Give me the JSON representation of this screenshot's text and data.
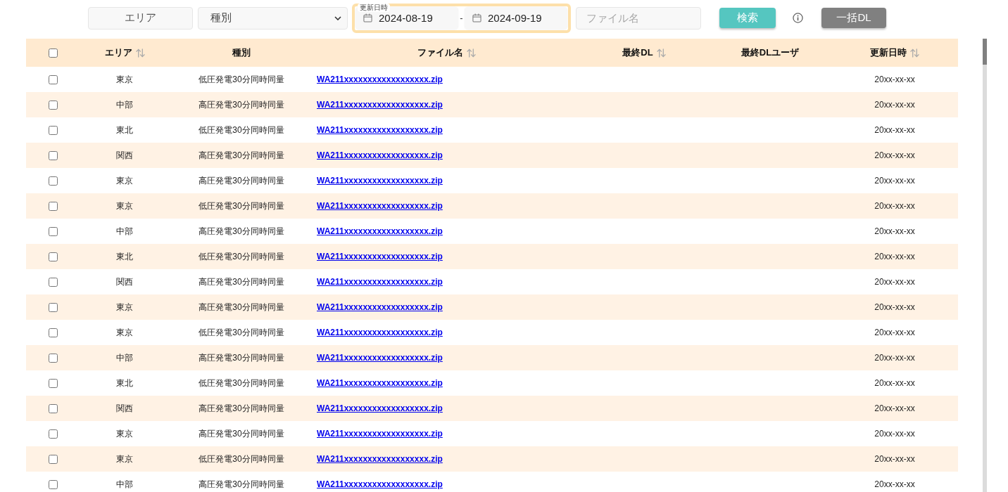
{
  "filters": {
    "area": {
      "label": "エリア"
    },
    "type_select": {
      "value": "種別"
    },
    "date_range": {
      "legend": "更新日時",
      "from": "2024-08-19",
      "separator": "-",
      "to": "2024-09-19"
    },
    "file_name": {
      "placeholder": "ファイル名"
    }
  },
  "search_button": {
    "label": "検索"
  },
  "bulk_download_button": {
    "label": "一括DL"
  },
  "table": {
    "select_all": {
      "checked": false
    },
    "columns": [
      {
        "label": "エリア",
        "sortable": true
      },
      {
        "label": "種別",
        "sortable": false
      },
      {
        "label": "ファイル名",
        "sortable": true
      },
      {
        "label": "最終DL",
        "sortable": true
      },
      {
        "label": "最終DLユーザ",
        "sortable": false
      },
      {
        "label": "更新日時",
        "sortable": true
      }
    ],
    "rows": [
      {
        "checked": false,
        "area": "東京",
        "type": "低圧発電30分同時同量",
        "file": "WA211xxxxxxxxxxxxxxxxxx.zip",
        "updated": "20xx-xx-xx"
      },
      {
        "checked": false,
        "area": "中部",
        "type": "高圧発電30分同時同量",
        "file": "WA211xxxxxxxxxxxxxxxxxx.zip",
        "updated": "20xx-xx-xx"
      },
      {
        "checked": false,
        "area": "東北",
        "type": "低圧発電30分同時同量",
        "file": "WA211xxxxxxxxxxxxxxxxxx.zip",
        "updated": "20xx-xx-xx"
      },
      {
        "checked": false,
        "area": "関西",
        "type": "高圧発電30分同時同量",
        "file": "WA211xxxxxxxxxxxxxxxxxx.zip",
        "updated": "20xx-xx-xx"
      },
      {
        "checked": false,
        "area": "東京",
        "type": "高圧発電30分同時同量",
        "file": "WA211xxxxxxxxxxxxxxxxxx.zip",
        "updated": "20xx-xx-xx"
      },
      {
        "checked": false,
        "area": "東京",
        "type": "低圧発電30分同時同量",
        "file": "WA211xxxxxxxxxxxxxxxxxx.zip",
        "updated": "20xx-xx-xx"
      },
      {
        "checked": false,
        "area": "中部",
        "type": "高圧発電30分同時同量",
        "file": "WA211xxxxxxxxxxxxxxxxxx.zip",
        "updated": "20xx-xx-xx"
      },
      {
        "checked": false,
        "area": "東北",
        "type": "低圧発電30分同時同量",
        "file": "WA211xxxxxxxxxxxxxxxxxx.zip",
        "updated": "20xx-xx-xx"
      },
      {
        "checked": false,
        "area": "関西",
        "type": "高圧発電30分同時同量",
        "file": "WA211xxxxxxxxxxxxxxxxxx.zip",
        "updated": "20xx-xx-xx"
      },
      {
        "checked": false,
        "area": "東京",
        "type": "高圧発電30分同時同量",
        "file": "WA211xxxxxxxxxxxxxxxxxx.zip",
        "updated": "20xx-xx-xx"
      },
      {
        "checked": false,
        "area": "東京",
        "type": "低圧発電30分同時同量",
        "file": "WA211xxxxxxxxxxxxxxxxxx.zip",
        "updated": "20xx-xx-xx"
      },
      {
        "checked": false,
        "area": "中部",
        "type": "高圧発電30分同時同量",
        "file": "WA211xxxxxxxxxxxxxxxxxx.zip",
        "updated": "20xx-xx-xx"
      },
      {
        "checked": false,
        "area": "東北",
        "type": "低圧発電30分同時同量",
        "file": "WA211xxxxxxxxxxxxxxxxxx.zip",
        "updated": "20xx-xx-xx"
      },
      {
        "checked": false,
        "area": "関西",
        "type": "高圧発電30分同時同量",
        "file": "WA211xxxxxxxxxxxxxxxxxx.zip",
        "updated": "20xx-xx-xx"
      },
      {
        "checked": false,
        "area": "東京",
        "type": "高圧発電30分同時同量",
        "file": "WA211xxxxxxxxxxxxxxxxxx.zip",
        "updated": "20xx-xx-xx"
      },
      {
        "checked": false,
        "area": "東京",
        "type": "低圧発電30分同時同量",
        "file": "WA211xxxxxxxxxxxxxxxxxx.zip",
        "updated": "20xx-xx-xx"
      },
      {
        "checked": false,
        "area": "中部",
        "type": "高圧発電30分同時同量",
        "file": "WA211xxxxxxxxxxxxxxxxxx.zip",
        "updated": "20xx-xx-xx"
      }
    ]
  }
}
